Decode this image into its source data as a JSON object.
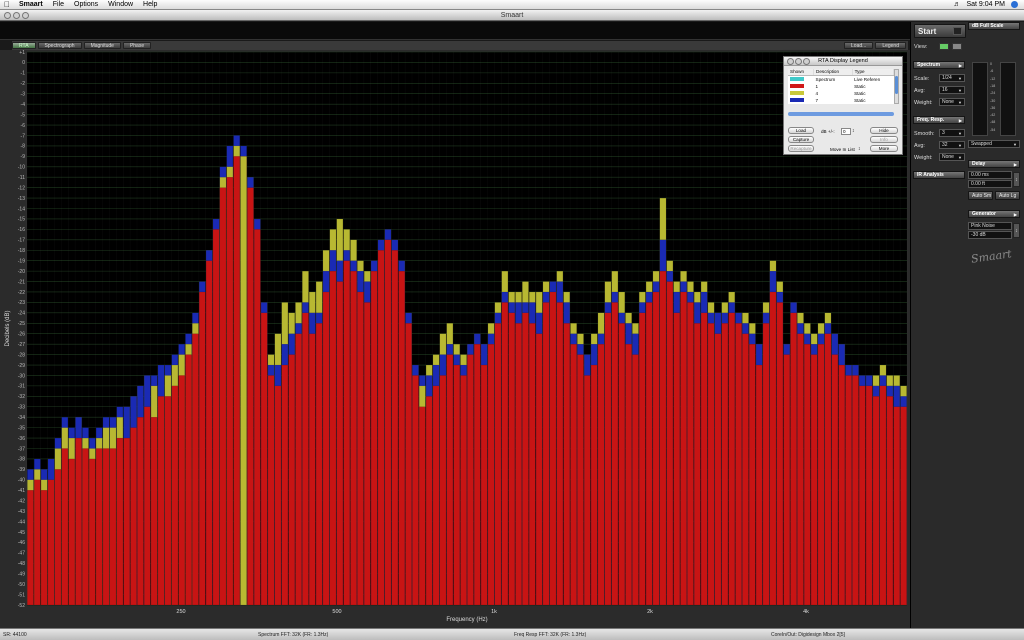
{
  "menubar": {
    "items": [
      "Smaart",
      "File",
      "Options",
      "Window",
      "Help"
    ],
    "clock": "Sat 9:04 PM"
  },
  "window": {
    "title": "Smaart"
  },
  "tabs": {
    "left": [
      "RTA",
      "Spectrograph",
      "Magnitude",
      "Phase"
    ],
    "right": [
      "Load...",
      "Legend"
    ]
  },
  "axes": {
    "ylabel": "Decibels (dB)",
    "xlabel": "Frequency (Hz)",
    "xticks": [
      "250",
      "500",
      "1k",
      "2k",
      "4k"
    ]
  },
  "chart_data": {
    "type": "bar",
    "title": "",
    "xlabel": "Frequency (Hz)",
    "ylabel": "Decibels (dB)",
    "ylim": [
      -52,
      1
    ],
    "yticks": [
      "+1",
      "0",
      "-1",
      "-2",
      "-3",
      "-4",
      "-5",
      "-6",
      "-7",
      "-8",
      "-9",
      "-10",
      "-11",
      "-12",
      "-13",
      "-14",
      "-15",
      "-16",
      "-17",
      "-18",
      "-19",
      "-20",
      "-21",
      "-22",
      "-23",
      "-24",
      "-25",
      "-26",
      "-27",
      "-28",
      "-29",
      "-30",
      "-31",
      "-32",
      "-33",
      "-34",
      "-35",
      "-36",
      "-37",
      "-38",
      "-39",
      "-40",
      "-41",
      "-42",
      "-43",
      "-44",
      "-45",
      "-46",
      "-47",
      "-48",
      "-49",
      "-50",
      "-51",
      "-52"
    ],
    "xticks": [
      "250",
      "500",
      "1k",
      "2k",
      "4k"
    ],
    "x_scale": "log",
    "series": [
      {
        "name": "1",
        "color": "#c81414",
        "values": [
          -41,
          -40,
          -41,
          -40,
          -39,
          -37,
          -38,
          -36,
          -37,
          -38,
          -37,
          -37,
          -37,
          -36,
          -36,
          -35,
          -34,
          -33,
          -34,
          -32,
          -32,
          -31,
          -30,
          -28,
          -26,
          -22,
          -19,
          -16,
          -12,
          -11,
          -9,
          -9,
          -12,
          -16,
          -24,
          -30,
          -31,
          -29,
          -28,
          -26,
          -24,
          -26,
          -25,
          -22,
          -20,
          -21,
          -19,
          -20,
          -22,
          -23,
          -20,
          -18,
          -17,
          -18,
          -20,
          -25,
          -30,
          -33,
          -32,
          -31,
          -30,
          -28,
          -29,
          -30,
          -28,
          -27,
          -29,
          -27,
          -25,
          -23,
          -24,
          -25,
          -24,
          -25,
          -26,
          -23,
          -22,
          -23,
          -25,
          -27,
          -28,
          -30,
          -29,
          -27,
          -24,
          -23,
          -25,
          -27,
          -28,
          -24,
          -23,
          -22,
          -20,
          -21,
          -24,
          -22,
          -23,
          -25,
          -24,
          -25,
          -26,
          -25,
          -24,
          -25,
          -26,
          -27,
          -29,
          -25,
          -22,
          -23,
          -28,
          -24,
          -26,
          -27,
          -28,
          -27,
          -26,
          -28,
          -29,
          -30,
          -30,
          -31,
          -31,
          -32,
          -31,
          -32,
          -33,
          -33
        ]
      },
      {
        "name": "4",
        "color": "#b8b832",
        "values": [
          -40,
          -39,
          -40,
          -38,
          -37,
          -35,
          -36,
          -34,
          -36,
          -37,
          -36,
          -35,
          -35,
          -34,
          -33,
          -32,
          -31,
          -30,
          -31,
          -29,
          -30,
          -29,
          -28,
          -27,
          -25,
          -21,
          -18,
          -15,
          -11,
          -10,
          -8,
          -9,
          -11,
          -15,
          -23,
          -28,
          -26,
          -23,
          -24,
          -23,
          -20,
          -22,
          -21,
          -18,
          -16,
          -15,
          -16,
          -17,
          -19,
          -20,
          -19,
          -17,
          -16,
          -17,
          -19,
          -24,
          -29,
          -31,
          -29,
          -28,
          -26,
          -25,
          -27,
          -28,
          -27,
          -26,
          -27,
          -25,
          -23,
          -20,
          -22,
          -22,
          -21,
          -22,
          -22,
          -21,
          -21,
          -20,
          -22,
          -25,
          -26,
          -28,
          -26,
          -24,
          -21,
          -20,
          -22,
          -24,
          -25,
          -22,
          -21,
          -20,
          -13,
          -19,
          -21,
          -20,
          -21,
          -22,
          -21,
          -23,
          -24,
          -23,
          -22,
          -24,
          -24,
          -25,
          -27,
          -23,
          -19,
          -21,
          -27,
          -23,
          -24,
          -25,
          -26,
          -25,
          -24,
          -26,
          -27,
          -29,
          -29,
          -30,
          -30,
          -30,
          -29,
          -30,
          -30,
          -31
        ]
      },
      {
        "name": "7",
        "color": "#1a2ab4",
        "values": [
          -39,
          -38,
          -39,
          -38,
          -36,
          -34,
          -35,
          -34,
          -35,
          -36,
          -35,
          -34,
          -34,
          -33,
          -33,
          -32,
          -31,
          -30,
          -30,
          -29,
          -29,
          -28,
          -27,
          -26,
          -24,
          -21,
          -18,
          -15,
          -10,
          -8,
          -7,
          -8,
          -11,
          -15,
          -23,
          -29,
          -29,
          -27,
          -26,
          -25,
          -23,
          -24,
          -24,
          -20,
          -18,
          -19,
          -18,
          -19,
          -20,
          -21,
          -19,
          -17,
          -16,
          -17,
          -19,
          -24,
          -29,
          -30,
          -30,
          -29,
          -28,
          -27,
          -28,
          -29,
          -27,
          -26,
          -27,
          -26,
          -24,
          -22,
          -23,
          -23,
          -23,
          -23,
          -24,
          -22,
          -21,
          -21,
          -23,
          -26,
          -27,
          -28,
          -27,
          -26,
          -23,
          -22,
          -24,
          -25,
          -26,
          -23,
          -22,
          -21,
          -17,
          -20,
          -22,
          -21,
          -22,
          -23,
          -22,
          -24,
          -24,
          -24,
          -23,
          -24,
          -25,
          -26,
          -27,
          -24,
          -20,
          -22,
          -27,
          -23,
          -25,
          -26,
          -27,
          -26,
          -25,
          -26,
          -27,
          -29,
          -29,
          -30,
          -30,
          -31,
          -30,
          -31,
          -31,
          -32
        ]
      }
    ]
  },
  "rpanel": {
    "start": "Start",
    "view": "View:",
    "dbfull": "dB Full Scale",
    "spectrum": "Spectrum",
    "scale_label": "Scale:",
    "scale": "1/24",
    "avg_label": "Avg:",
    "avg": "16",
    "weight_label": "Weight:",
    "weight": "None",
    "freq": "Freq. Resp.",
    "smooth_label": "Smooth:",
    "smooth": "3",
    "avg2_label": "Avg:",
    "avg2": "32",
    "weight2_label": "Weight:",
    "weight2": "None",
    "ir": "IR Analysis",
    "swapped": "Swapped",
    "delay": "Delay",
    "delay_ms": "0.00 ms",
    "delay_ft": "0.00 ft",
    "autosm": "Auto Sm",
    "autolg": "Auto Lg",
    "generator": "Generator",
    "gen_type": "Pink Noise",
    "gen_level": "-30 dB",
    "logo": "Smaart",
    "meter_labels": [
      "0",
      "-6",
      "-12",
      "-18",
      "-24",
      "-30",
      "-36",
      "-42",
      "-48",
      "-54"
    ]
  },
  "legend": {
    "title": "RTA Display Legend",
    "headers": [
      "Shown",
      "Description",
      "Type"
    ],
    "rows": [
      {
        "color": "#3fc9c9",
        "desc": "Spectrum",
        "type": "Live Referen"
      },
      {
        "color": "#d01818",
        "desc": "1",
        "type": "Static"
      },
      {
        "color": "#c8c83a",
        "desc": "4",
        "type": "Static"
      },
      {
        "color": "#1a2ab4",
        "desc": "7",
        "type": "Static"
      }
    ],
    "load": "Load",
    "capture": "Capture",
    "recapture": "Recapture",
    "db_label": "dB +/-:",
    "db_value": "0",
    "move": "Move In List",
    "hide": "Hide",
    "info": "Info",
    "more": "More"
  },
  "status": {
    "sr": "SR: 44100",
    "spectrum": "Spectrum FFT: 32K (FR: 1.3Hz)",
    "freq": "Freq Resp FFT: 32K (FR: 1.3Hz)",
    "device": "CoreIn/Out: Digidesign Mbox 2[5]"
  }
}
